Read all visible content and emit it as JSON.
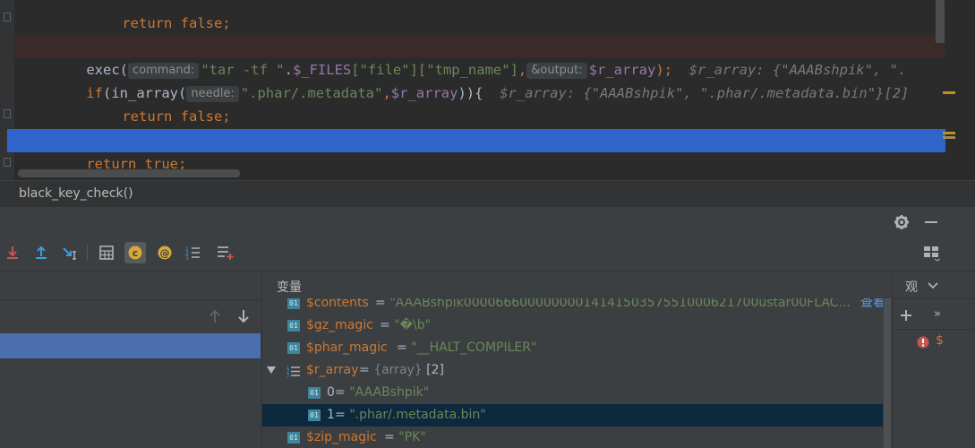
{
  "editor": {
    "line0_text": "return false;",
    "line1_text": "}",
    "line2": {
      "func": "exec(",
      "hint1": "command:",
      "arg1": "\"tar -tf \"",
      "dot": ".",
      "files_var": "$_FILES",
      "files_key1": "[\"file\"]",
      "files_key2": "[\"tmp_name\"]",
      "comma": ",",
      "hint2": "&output:",
      "out_var": "$r_array",
      "end": ");",
      "inline": "$r_array: {\"AAABshpik\", \"."
    },
    "line3": {
      "kw_if": "if",
      "func": "(in_array(",
      "hint": "needle:",
      "arg": "\".phar/.metadata\"",
      "comma": ",",
      "var": "$r_array",
      "end": ")){",
      "inline": "$r_array: {\"AAABshpik\", \".phar/.metadata.bin\"}[2]"
    },
    "line4_text": "return false;",
    "line5_text": "}",
    "line6_text": "return true;",
    "line7_text": "}"
  },
  "breadcrumb": {
    "text": "black_key_check()"
  },
  "variables": {
    "title": "变量",
    "rows": [
      {
        "name": "$contents",
        "eq": " = ",
        "value": "\"AAABshpik0000666000000001414150357551000621700ustar00FLAC...",
        "link": "查看"
      },
      {
        "name": "$gz_magic",
        "eq": " = ",
        "value": "\"\u001f�\\b\""
      },
      {
        "name": "$phar_magic",
        "eq": " = ",
        "value": "\"__HALT_COMPILER\""
      },
      {
        "name": "$r_array",
        "eq": " = ",
        "type": "{array}",
        "count": "[2]"
      },
      {
        "name": "0",
        "eq": " = ",
        "value": "\"AAABshpik\""
      },
      {
        "name": "1",
        "eq": " = ",
        "value": "\".phar/.metadata.bin\""
      },
      {
        "name": "$zip_magic",
        "eq": " = ",
        "value": "\"PK\u0003\u0004\""
      }
    ]
  },
  "watches": {
    "title": "观",
    "error_item": "$"
  },
  "icons": {
    "gear": "gear-icon",
    "minimize": "minimize-icon"
  },
  "colors": {
    "accent": "#2f65ca",
    "frame_selected": "#4b6eaf",
    "keyword": "#cc7832",
    "string": "#6a8759",
    "variable": "#9876aa"
  }
}
